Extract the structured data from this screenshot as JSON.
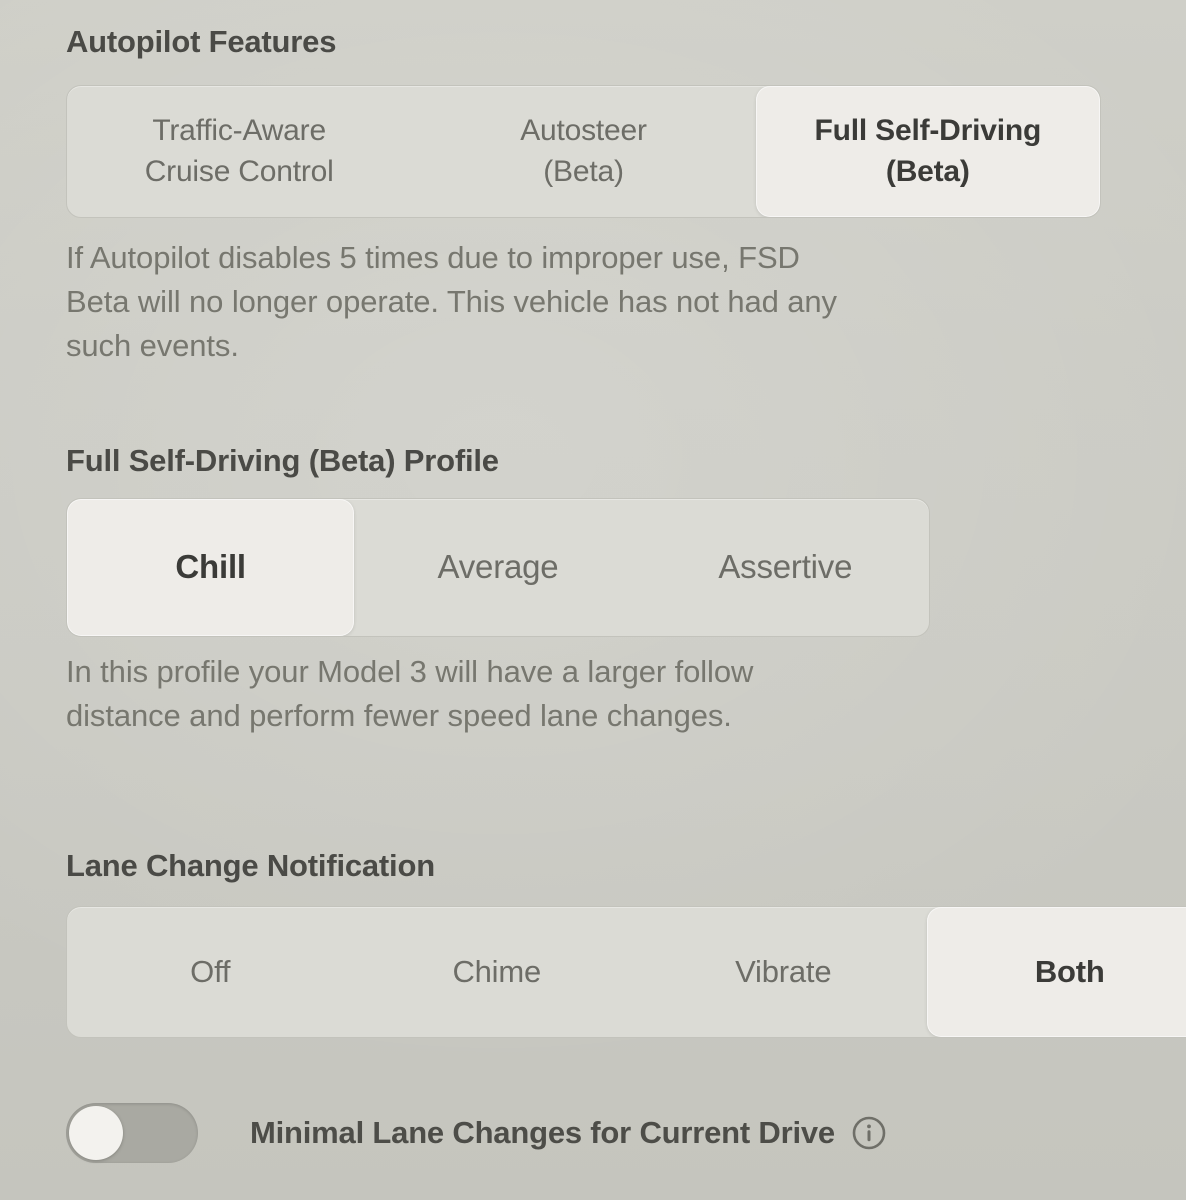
{
  "theme": {
    "background": "#cbcbc4",
    "track": "#dbdbd5",
    "selected_pill": "#eeece8",
    "heading_text": "#4a4a46",
    "body_text": "#77776f",
    "segment_text": "#6d6d67",
    "toggle_track_off": "#a9a9a2",
    "toggle_knob": "#f3f2ee"
  },
  "autopilot_features": {
    "heading": "Autopilot Features",
    "options": [
      {
        "label": "Traffic-Aware\nCruise Control",
        "selected": false
      },
      {
        "label": "Autosteer\n(Beta)",
        "selected": false
      },
      {
        "label": "Full Self-Driving\n(Beta)",
        "selected": true
      }
    ],
    "selected_value": "Full Self-Driving (Beta)",
    "description": "If Autopilot disables 5 times due to improper use, FSD Beta will no longer operate. This vehicle has not had any such events."
  },
  "fsd_profile": {
    "heading": "Full Self-Driving (Beta) Profile",
    "options": [
      {
        "label": "Chill",
        "selected": true
      },
      {
        "label": "Average",
        "selected": false
      },
      {
        "label": "Assertive",
        "selected": false
      }
    ],
    "selected_value": "Chill",
    "description": "In this profile your Model 3 will have a larger follow distance and perform fewer speed lane changes."
  },
  "lane_change_notification": {
    "heading": "Lane Change Notification",
    "options": [
      {
        "label": "Off",
        "selected": false
      },
      {
        "label": "Chime",
        "selected": false
      },
      {
        "label": "Vibrate",
        "selected": false
      },
      {
        "label": "Both",
        "selected": true
      }
    ],
    "selected_value": "Both"
  },
  "minimal_lane_changes": {
    "label": "Minimal Lane Changes for Current Drive",
    "toggle_state": "off",
    "info_icon": "info-circle-icon"
  }
}
